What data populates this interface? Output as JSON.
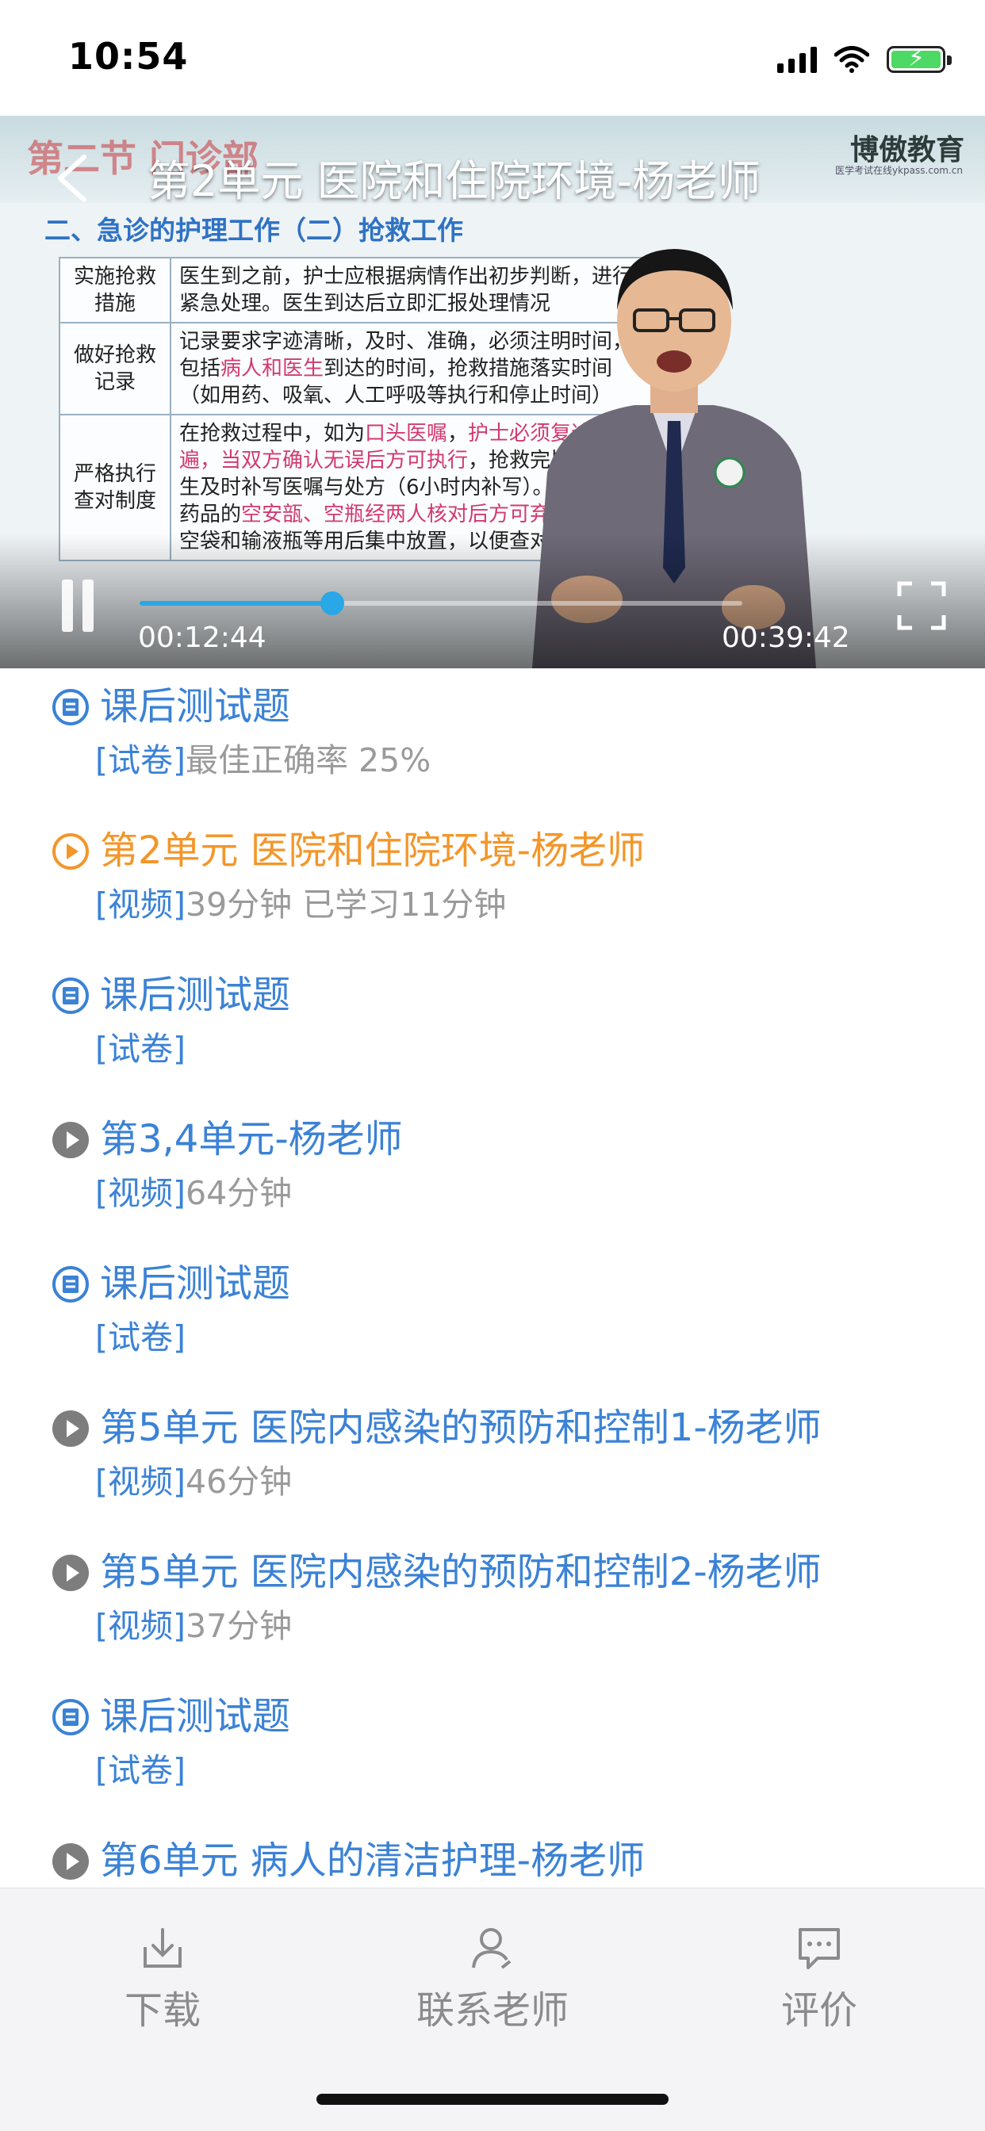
{
  "status_bar": {
    "time": "10:54"
  },
  "video": {
    "title": "第2单元 医院和住院环境-杨老师",
    "current_time": "00:12:44",
    "total_time": "00:39:42",
    "progress_fraction": 0.32,
    "slide": {
      "top_title": "第二节 门诊部",
      "logo": "博傲教育",
      "logo_sub": "医学考试在线ykpass.com.cn",
      "subtitle": "二、急诊的护理工作（二）抢救工作",
      "rows": [
        {
          "key": "实施抢救措施",
          "text": "医生到之前，护士应根据病情作出初步判断，进行紧急处理。医生到达后立即汇报处理情况"
        },
        {
          "key": "做好抢救记录",
          "text": "记录要求字迹清晰，及时、准确，必须注明时间，包括病人和医生到达的时间，抢救措施落实时间（如用药、吸氧、人工呼吸等执行和停止时间）"
        },
        {
          "key": "严格执行查对制度",
          "text": "在抢救过程中，如为口头医嘱，护士必须复述一遍，当双方确认无误后方可执行，抢救完毕，请医生及时补写医嘱与处方（6小时内补写）。各种急救药品的空安瓿、空瓶经两人核对后方可弃去，输血空袋和输液瓶等用后集中放置，以便查对"
        }
      ]
    }
  },
  "list": [
    {
      "type": "quiz",
      "title": "课后测试题",
      "tag": "[试卷]",
      "detail": "最佳正确率 25%",
      "active": false
    },
    {
      "type": "video",
      "title": "第2单元 医院和住院环境-杨老师",
      "tag": "[视频]",
      "detail": "39分钟  已学习11分钟",
      "active": true
    },
    {
      "type": "quiz",
      "title": "课后测试题",
      "tag": "[试卷]",
      "detail": "",
      "active": false
    },
    {
      "type": "video",
      "title": "第3,4单元-杨老师",
      "tag": "[视频]",
      "detail": "64分钟",
      "active": false
    },
    {
      "type": "quiz",
      "title": "课后测试题",
      "tag": "[试卷]",
      "detail": "",
      "active": false
    },
    {
      "type": "video",
      "title": "第5单元 医院内感染的预防和控制1-杨老师",
      "tag": "[视频]",
      "detail": "46分钟",
      "active": false
    },
    {
      "type": "video",
      "title": "第5单元 医院内感染的预防和控制2-杨老师",
      "tag": "[视频]",
      "detail": "37分钟",
      "active": false
    },
    {
      "type": "quiz",
      "title": "课后测试题",
      "tag": "[试卷]",
      "detail": "",
      "active": false
    },
    {
      "type": "video",
      "title": "第6单元 病人的清洁护理-杨老师",
      "tag": "",
      "detail": "",
      "active": false
    }
  ],
  "bottom_bar": {
    "download": "下载",
    "contact": "联系老师",
    "review": "评价"
  },
  "colors": {
    "link_blue": "#3b82d6",
    "active_orange": "#f3962a",
    "progress_blue": "#2aa7e6",
    "meta_gray": "#9a9a9a"
  }
}
